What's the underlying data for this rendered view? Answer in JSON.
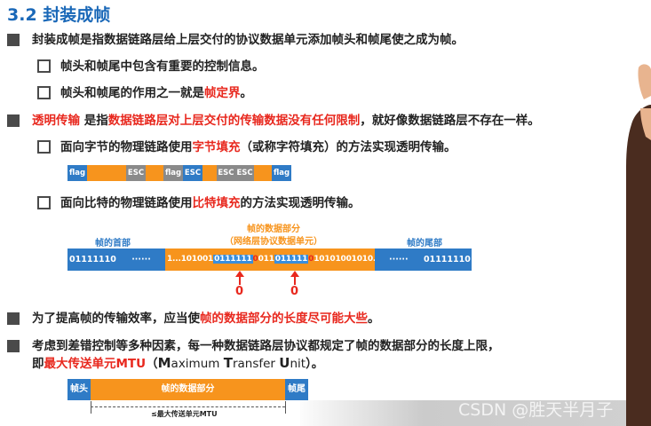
{
  "title": "3.2 封装成帧",
  "b1": {
    "text": "封装成帧是指数据链路层给上层交付的协议数据单元添加帧头和帧尾使之成为帧。"
  },
  "s1": {
    "text": "帧头和帧尾中包含有重要的控制信息。"
  },
  "s2": {
    "pre": "帧头和帧尾的作用之一就是",
    "red": "帧定界",
    "post": "。"
  },
  "b2": {
    "red1": "透明传输",
    "mid1": " 是指",
    "red2": "数据链路层对上层交付的传输数据没有任何限制",
    "post": "，就好像数据链路层不存在一样。"
  },
  "s3": {
    "pre": "面向字节的物理链路使用",
    "red": "字节填充",
    "post": "（或称字符填充）的方法实现透明传输。"
  },
  "byte_strip": {
    "flag": "flag",
    "esc": "ESC",
    "esc_esc": "ESC ESC"
  },
  "s4": {
    "pre": "面向比特的物理链路使用",
    "red": "比特填充",
    "post": "的方法实现透明传输。"
  },
  "bit_frame": {
    "head_label": "帧的首部",
    "data_label_1": "帧的数据部分",
    "data_label_2": "（网络层协议数据单元）",
    "tail_label": "帧的尾部",
    "head_bits": "01111110",
    "dots": "······",
    "data_1": "1...101001",
    "data_hl_1": "0111111",
    "data_stuff_1": "0",
    "data_2": "011",
    "data_hl_2": "011111",
    "data_stuff_2": "0",
    "data_3": "10101001010...0",
    "tail_bits": "01111110",
    "zero_1": "0",
    "zero_2": "0"
  },
  "b3": {
    "pre": "为了提高帧的传输效率，应当使",
    "red": "帧的数据部分的长度尽可能大些",
    "post": "。"
  },
  "b4": {
    "line1": "考虑到差错控制等多种因素，每一种数据链路层协议都规定了帧的数据部分的长度上限，",
    "line2_pre": "即",
    "line2_red": "最大传送单元MTU",
    "line2_open": "（",
    "m": "M",
    "aximum": "aximum ",
    "t": "T",
    "ransfer": "ransfer ",
    "u": "U",
    "nit": "nit",
    "line2_close": "）。"
  },
  "mtu": {
    "head": "帧头",
    "data": "帧的数据部分",
    "tail": "帧尾",
    "limit": "≤最大传送单元MTU"
  },
  "watermark": "CSDN @胜天半月子",
  "colors": {
    "title_blue": "#1a68b8",
    "red": "#e8281e",
    "blue": "#2f7bc6",
    "orange": "#f7941d",
    "gray": "#8a8a8a"
  }
}
